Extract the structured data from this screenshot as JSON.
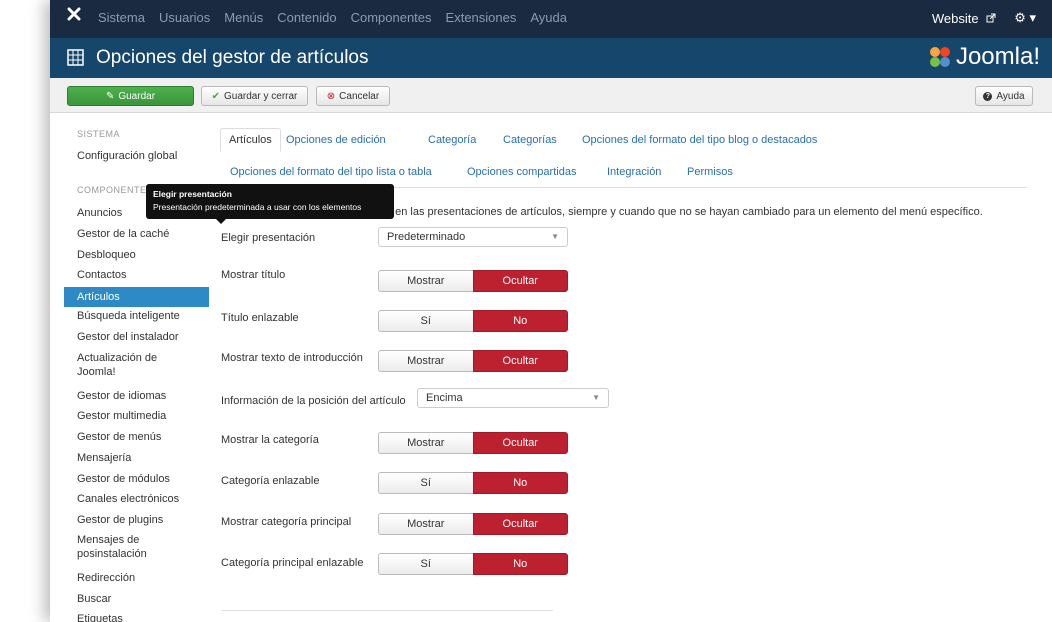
{
  "topbar": {
    "menu": [
      "Sistema",
      "Usuarios",
      "Menús",
      "Contenido",
      "Componentes",
      "Extensiones",
      "Ayuda"
    ],
    "website_label": "Website",
    "gear_caret": "▾"
  },
  "titlebar": {
    "title": "Opciones del gestor de artículos",
    "brand": "Joomla!"
  },
  "toolbar": {
    "save_label": "Guardar",
    "save_close_label": "Guardar y cerrar",
    "cancel_label": "Cancelar",
    "help_label": "Ayuda"
  },
  "sidebar": {
    "system_header": "SISTEMA",
    "system_item": "Configuración global",
    "components_header": "COMPONENTES",
    "items": [
      "Anuncios",
      "Gestor de la caché",
      "Desbloqueo",
      "Contactos",
      "Artículos",
      "Búsqueda inteligente",
      "Gestor del instalador",
      "Actualización de Joomla!",
      "Gestor de idiomas",
      "Gestor multimedia",
      "Gestor de menús",
      "Mensajería",
      "Gestor de módulos",
      "Canales electrónicos",
      "Gestor de plugins",
      "Mensajes de posinstalación",
      "Redirección",
      "Buscar",
      "Etiquetas"
    ],
    "active_item": "Artículos"
  },
  "tabs": {
    "row1": [
      "Artículos",
      "Opciones de edición",
      "Categoría",
      "Categorías",
      "Opciones del formato del tipo blog o destacados"
    ],
    "row2": [
      "Opciones del formato del tipo lista o tabla",
      "Opciones compartidas",
      "Integración",
      "Permisos"
    ],
    "active": "Artículos"
  },
  "intro_text": "ica en las presentaciones de artículos, siempre y cuando que no se hayan cambiado para un elemento del menú específico.",
  "tooltip": {
    "title": "Elegir presentación",
    "body": "Presentación predeterminada a usar con los elementos"
  },
  "form": {
    "layout": {
      "label": "Elegir presentación",
      "value": "Predeterminado"
    },
    "show_title": {
      "label": "Mostrar título",
      "off": "Mostrar",
      "on": "Ocultar"
    },
    "linked_title": {
      "label": "Título enlazable",
      "off": "Sí",
      "on": "No"
    },
    "show_intro": {
      "label": "Mostrar texto de introducción",
      "off": "Mostrar",
      "on": "Ocultar"
    },
    "info_position": {
      "label": "Información de la posición del artículo",
      "value": "Encima"
    },
    "show_category": {
      "label": "Mostrar la categoría",
      "off": "Mostrar",
      "on": "Ocultar"
    },
    "linked_category": {
      "label": "Categoría enlazable",
      "off": "Sí",
      "on": "No"
    },
    "show_parent": {
      "label": "Mostrar categoría principal",
      "off": "Mostrar",
      "on": "Ocultar"
    },
    "linked_parent": {
      "label": "Categoría principal enlazable",
      "off": "Sí",
      "on": "No"
    }
  },
  "colors": {
    "menubar": "#1a2a41",
    "titlebar": "#16466c",
    "save_green": "#46a546",
    "active_red": "#bd2130",
    "sidebar_active": "#2d8ac7",
    "link_blue": "#2a6fb0"
  },
  "icons": [
    "joomla-x-icon",
    "external-link-icon",
    "gear-icon",
    "grid-icon",
    "joomla-logo-icon",
    "edit-icon",
    "check-icon",
    "cancel-circle-icon",
    "help-circle-icon"
  ]
}
